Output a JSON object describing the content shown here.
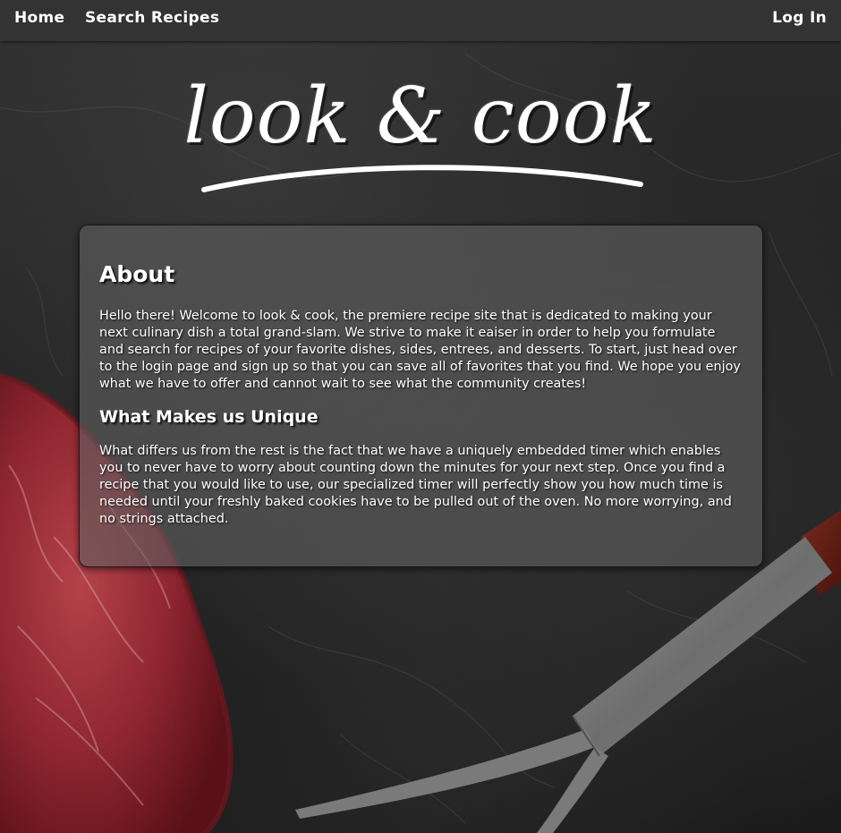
{
  "nav": {
    "home_label": "Home",
    "search_label": "Search Recipes",
    "login_label": "Log In"
  },
  "logo": {
    "text": "look & cook"
  },
  "about": {
    "heading": "About",
    "body": "Hello there! Welcome to look & cook, the premiere recipe site that is dedicated to making your next culinary dish a total grand-slam. We strive to make it eaiser in order to help you formulate and search for recipes of your favorite dishes, sides, entrees, and desserts. To start, just head over to the login page and sign up so that you can save all of favorites that you find. We hope you enjoy what we have to offer and cannot wait to see what the community creates!"
  },
  "unique": {
    "heading": "What Makes us Unique",
    "body": "What differs us from the rest is the fact that we have a uniquely embedded timer which enables you to never have to worry about counting down the minutes for your next step. Once you find a recipe that you would like to use, our specialized timer will perfectly show you how much time is needed until your freshly baked cookies have to be pulled out of the oven. No more worrying, and no strings attached."
  },
  "colors": {
    "navbar": "#333333",
    "nav_text": "#ffffff",
    "background": "#232323",
    "card": "#5f5f5f",
    "text": "#ffffff"
  },
  "icons": {
    "background_steak": "steak-image",
    "background_fork": "carving-fork-image"
  }
}
